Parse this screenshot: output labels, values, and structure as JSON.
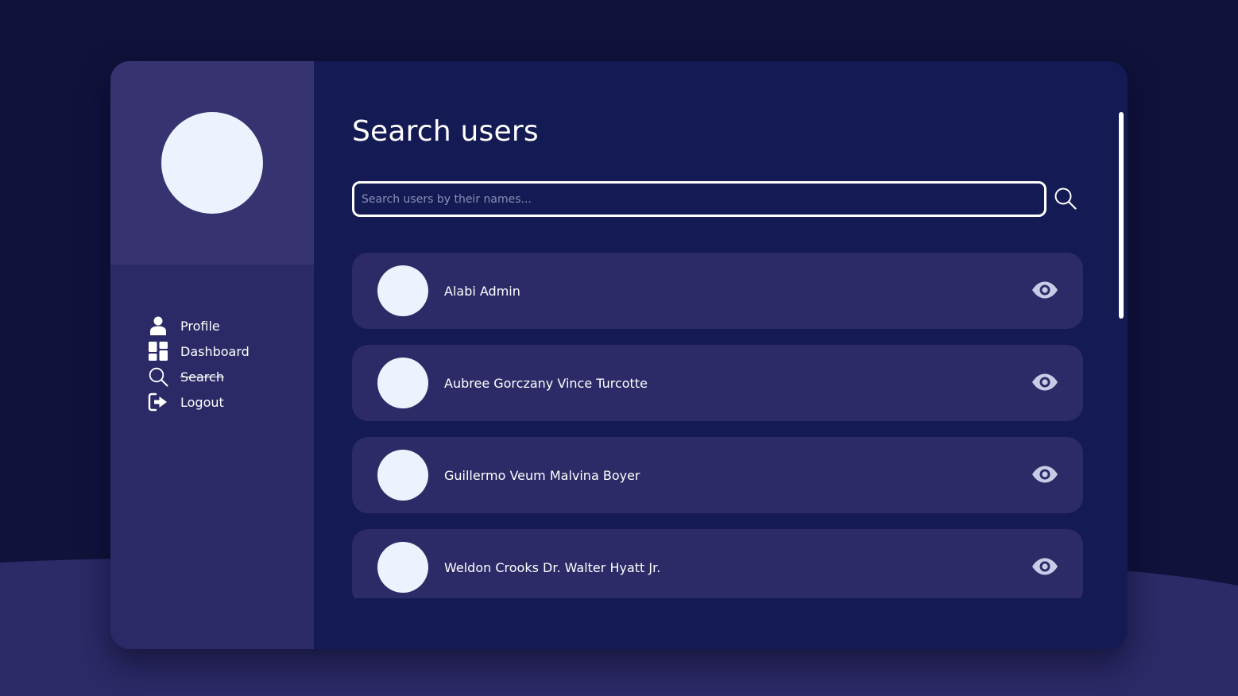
{
  "page": {
    "title": "Search users"
  },
  "search": {
    "placeholder": "Search users by their names...",
    "value": "",
    "button_icon": "search-icon"
  },
  "sidebar": {
    "items": [
      {
        "label": "Profile",
        "icon": "user-icon",
        "strikethrough": false
      },
      {
        "label": "Dashboard",
        "icon": "dashboard-icon",
        "strikethrough": false
      },
      {
        "label": "Search",
        "icon": "search-icon",
        "strikethrough": true
      },
      {
        "label": "Logout",
        "icon": "logout-icon",
        "strikethrough": false
      }
    ]
  },
  "results": [
    {
      "name": "Alabi Admin",
      "action_icon": "eye-icon"
    },
    {
      "name": "Aubree Gorczany Vince Turcotte",
      "action_icon": "eye-icon"
    },
    {
      "name": "Guillermo Veum Malvina Boyer",
      "action_icon": "eye-icon"
    },
    {
      "name": "Weldon Crooks Dr. Walter Hyatt Jr.",
      "action_icon": "eye-icon"
    }
  ],
  "colors": {
    "background": "#10123b",
    "card": "#141a53",
    "sidebar": "#2b2a66",
    "sidebar_header": "#363370",
    "result_card": "#2c2a67",
    "avatar": "#edf3fe",
    "eye_icon": "#c9cce6",
    "text": "#ffffff"
  }
}
